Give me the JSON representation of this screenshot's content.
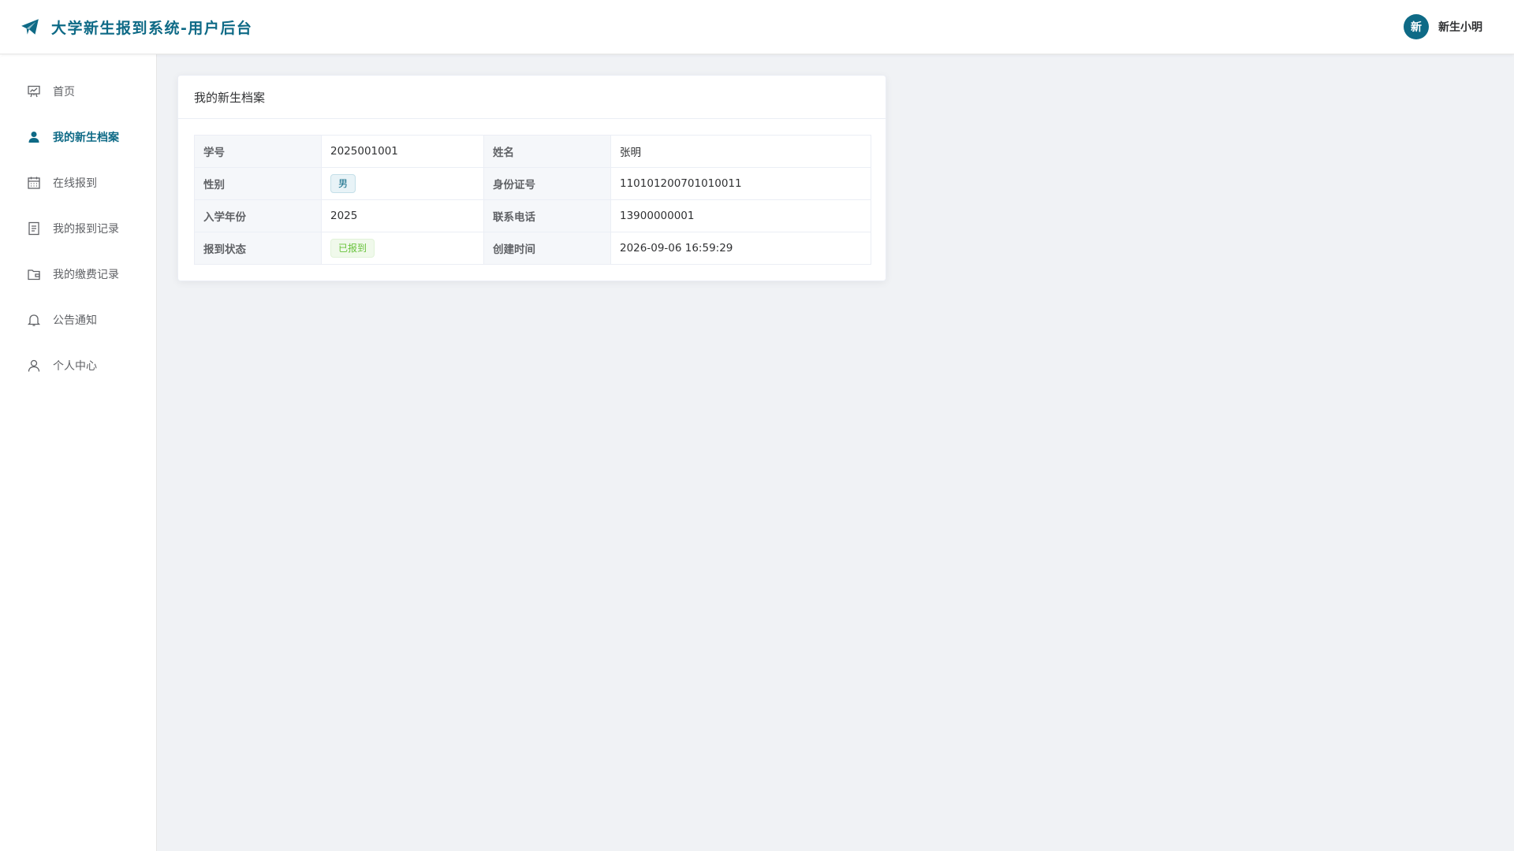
{
  "header": {
    "title": "大学新生报到系统-用户后台",
    "logo_icon": "paper-plane-icon",
    "user": {
      "avatar_text": "新",
      "name": "新生小明"
    }
  },
  "sidebar": {
    "items": [
      {
        "label": "首页",
        "icon": "presentation-chart-icon",
        "active": false
      },
      {
        "label": "我的新生档案",
        "icon": "user-filled-icon",
        "active": true
      },
      {
        "label": "在线报到",
        "icon": "calendar-icon",
        "active": false
      },
      {
        "label": "我的报到记录",
        "icon": "document-icon",
        "active": false
      },
      {
        "label": "我的缴费记录",
        "icon": "wallet-icon",
        "active": false
      },
      {
        "label": "公告通知",
        "icon": "bell-icon",
        "active": false
      },
      {
        "label": "个人中心",
        "icon": "user-outline-icon",
        "active": false
      }
    ]
  },
  "profile": {
    "title": "我的新生档案",
    "rows": [
      {
        "label1": "学号",
        "value1": "2025001001",
        "label2": "姓名",
        "value2": "张明"
      },
      {
        "label1": "性别",
        "value1": "男",
        "label2": "身份证号",
        "value2": "110101200701010011"
      },
      {
        "label1": "入学年份",
        "value1": "2025",
        "label2": "联系电话",
        "value2": "13900000001"
      },
      {
        "label1": "报到状态",
        "value1": "已报到",
        "label2": "创建时间",
        "value2": "2026-09-06 16:59:29"
      }
    ]
  },
  "colors": {
    "brand": "#0e6a86",
    "tag_success": "#67c23a",
    "page_bg": "#f0f2f5"
  }
}
